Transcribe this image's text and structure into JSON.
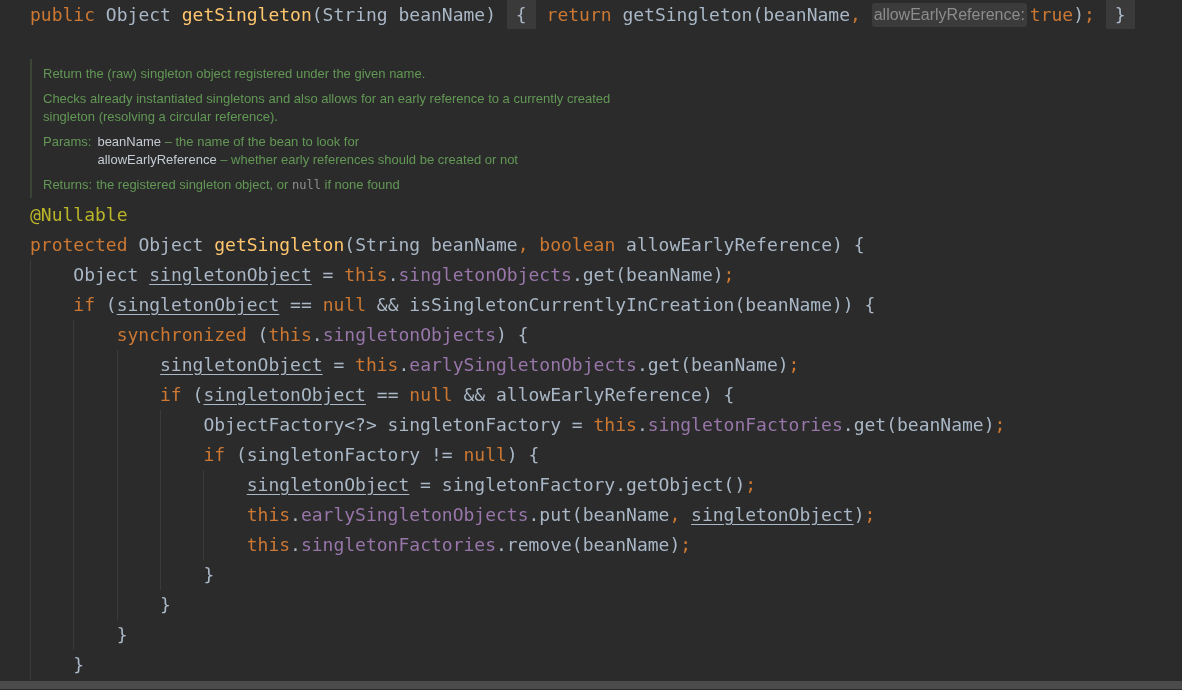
{
  "header_line": {
    "tokens": [
      {
        "text": "public",
        "kind": "keyword"
      },
      {
        "text": " Object ",
        "kind": "plain"
      },
      {
        "text": "getSingleton",
        "kind": "method"
      },
      {
        "text": "(String beanName) ",
        "kind": "plain"
      },
      {
        "text": "{",
        "kind": "fold"
      },
      {
        "text": " return",
        "kind": "keyword"
      },
      {
        "text": " getSingleton(beanName",
        "kind": "plain"
      },
      {
        "text": ", ",
        "kind": "keyword"
      },
      {
        "text": "allowEarlyReference:",
        "kind": "hint"
      },
      {
        "text": "true",
        "kind": "keyword"
      },
      {
        "text": ")",
        "kind": "plain"
      },
      {
        "text": "; ",
        "kind": "keyword"
      },
      {
        "text": "}",
        "kind": "fold"
      }
    ]
  },
  "doc": {
    "summary": "Return the (raw) singleton object registered under the given name.",
    "description": "Checks already instantiated singletons and also allows for an early reference to a currently created singleton (resolving a circular reference).",
    "params_label": "Params:",
    "params": [
      {
        "name": "beanName",
        "description": "– the name of the bean to look for"
      },
      {
        "name": "allowEarlyReference",
        "description": "– whether early references should be created or not"
      }
    ],
    "returns_label": "Returns:",
    "returns": [
      {
        "text": "the registered singleton object, or ",
        "kind": "text"
      },
      {
        "text": "null",
        "kind": "code"
      },
      {
        "text": " if none found",
        "kind": "text"
      }
    ]
  },
  "lines": [
    {
      "tokens": [
        {
          "text": "@Nullable",
          "kind": "annotation"
        }
      ]
    },
    {
      "tokens": [
        {
          "text": "protected",
          "kind": "keyword"
        },
        {
          "text": " Object ",
          "kind": "plain"
        },
        {
          "text": "getSingleton",
          "kind": "method"
        },
        {
          "text": "(String beanName",
          "kind": "plain"
        },
        {
          "text": ", boolean",
          "kind": "keyword"
        },
        {
          "text": " allowEarlyReference) {",
          "kind": "plain"
        }
      ]
    },
    {
      "tokens": [
        {
          "text": "    Object ",
          "kind": "plain"
        },
        {
          "text": "singletonObject",
          "kind": "reassigned"
        },
        {
          "text": " = ",
          "kind": "plain"
        },
        {
          "text": "this",
          "kind": "keyword"
        },
        {
          "text": ".",
          "kind": "plain"
        },
        {
          "text": "singletonObjects",
          "kind": "field"
        },
        {
          "text": ".get(beanName)",
          "kind": "plain"
        },
        {
          "text": ";",
          "kind": "keyword"
        }
      ]
    },
    {
      "tokens": [
        {
          "text": "    if",
          "kind": "keyword"
        },
        {
          "text": " (",
          "kind": "plain"
        },
        {
          "text": "singletonObject",
          "kind": "reassigned"
        },
        {
          "text": " == ",
          "kind": "plain"
        },
        {
          "text": "null",
          "kind": "keyword"
        },
        {
          "text": " && isSingletonCurrentlyInCreation(beanName)) {",
          "kind": "plain"
        }
      ]
    },
    {
      "tokens": [
        {
          "text": "        synchronized",
          "kind": "keyword"
        },
        {
          "text": " (",
          "kind": "plain"
        },
        {
          "text": "this",
          "kind": "keyword"
        },
        {
          "text": ".",
          "kind": "plain"
        },
        {
          "text": "singletonObjects",
          "kind": "field"
        },
        {
          "text": ") {",
          "kind": "plain"
        }
      ]
    },
    {
      "tokens": [
        {
          "text": "            singletonObject",
          "kind": "reassigned"
        },
        {
          "text": " = ",
          "kind": "plain"
        },
        {
          "text": "this",
          "kind": "keyword"
        },
        {
          "text": ".",
          "kind": "plain"
        },
        {
          "text": "earlySingletonObjects",
          "kind": "field"
        },
        {
          "text": ".get(beanName)",
          "kind": "plain"
        },
        {
          "text": ";",
          "kind": "keyword"
        }
      ]
    },
    {
      "tokens": [
        {
          "text": "            if",
          "kind": "keyword"
        },
        {
          "text": " (",
          "kind": "plain"
        },
        {
          "text": "singletonObject",
          "kind": "reassigned"
        },
        {
          "text": " == ",
          "kind": "plain"
        },
        {
          "text": "null",
          "kind": "keyword"
        },
        {
          "text": " && allowEarlyReference) {",
          "kind": "plain"
        }
      ]
    },
    {
      "tokens": [
        {
          "text": "                ObjectFactory<?> singletonFactory = ",
          "kind": "plain"
        },
        {
          "text": "this",
          "kind": "keyword"
        },
        {
          "text": ".",
          "kind": "plain"
        },
        {
          "text": "singletonFactories",
          "kind": "field"
        },
        {
          "text": ".get(beanName)",
          "kind": "plain"
        },
        {
          "text": ";",
          "kind": "keyword"
        }
      ]
    },
    {
      "tokens": [
        {
          "text": "                if",
          "kind": "keyword"
        },
        {
          "text": " (singletonFactory != ",
          "kind": "plain"
        },
        {
          "text": "null",
          "kind": "keyword"
        },
        {
          "text": ") {",
          "kind": "plain"
        }
      ]
    },
    {
      "tokens": [
        {
          "text": "                    singletonObject",
          "kind": "reassigned"
        },
        {
          "text": " = singletonFactory.getObject()",
          "kind": "plain"
        },
        {
          "text": ";",
          "kind": "keyword"
        }
      ]
    },
    {
      "tokens": [
        {
          "text": "                    this",
          "kind": "keyword"
        },
        {
          "text": ".",
          "kind": "plain"
        },
        {
          "text": "earlySingletonObjects",
          "kind": "field"
        },
        {
          "text": ".put(beanName",
          "kind": "plain"
        },
        {
          "text": ", ",
          "kind": "keyword"
        },
        {
          "text": "singletonObject",
          "kind": "reassigned"
        },
        {
          "text": ")",
          "kind": "plain"
        },
        {
          "text": ";",
          "kind": "keyword"
        }
      ]
    },
    {
      "tokens": [
        {
          "text": "                    this",
          "kind": "keyword"
        },
        {
          "text": ".",
          "kind": "plain"
        },
        {
          "text": "singletonFactories",
          "kind": "field"
        },
        {
          "text": ".remove(beanName)",
          "kind": "plain"
        },
        {
          "text": ";",
          "kind": "keyword"
        }
      ]
    },
    {
      "tokens": [
        {
          "text": "                }",
          "kind": "plain"
        }
      ]
    },
    {
      "tokens": [
        {
          "text": "            }",
          "kind": "plain"
        }
      ]
    },
    {
      "tokens": [
        {
          "text": "        }",
          "kind": "plain"
        }
      ]
    },
    {
      "tokens": [
        {
          "text": "    }",
          "kind": "plain"
        }
      ]
    }
  ]
}
